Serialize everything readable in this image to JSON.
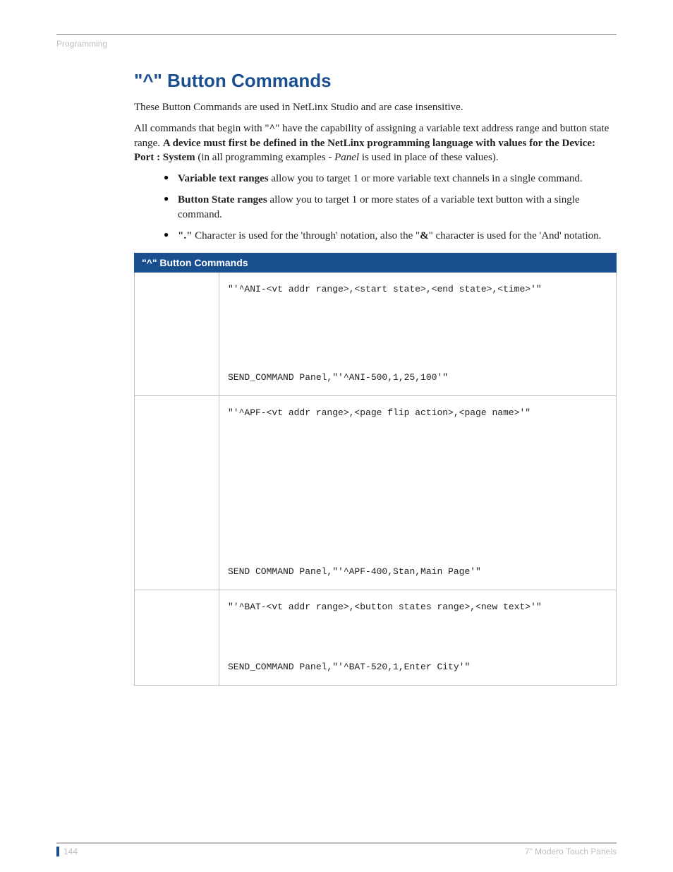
{
  "header": {
    "section": "Programming"
  },
  "title": "\"^\" Button Commands",
  "intro1": "These Button Commands are used in NetLinx Studio and are case insensitive.",
  "intro2_pre": "All commands that begin with \"",
  "intro2_sym": "^",
  "intro2_mid": "\" have the capability of assigning a variable text address range and button state range. ",
  "intro2_bold": "A device must first be defined in the NetLinx programming language with values for the Device: Port : System",
  "intro2_post1": " (in all programming examples - ",
  "intro2_panel": "Panel",
  "intro2_post2": " is used in place of these values).",
  "bullets": {
    "b1_bold": "Variable text ranges",
    "b1_rest": " allow you to target 1 or more variable text channels in a single command.",
    "b2_bold": "Button State ranges",
    "b2_rest": " allow you to target 1 or more states of a variable text button with a single command.",
    "b3_bold": "\".\"",
    "b3_mid": " Character is used for the 'through' notation, also the \"",
    "b3_amp": "&",
    "b3_rest": "\" character is used for the 'And' notation."
  },
  "table": {
    "header": "\"^\" Button Commands",
    "rows": [
      {
        "syntax": "\"'^ANI-<vt addr range>,<start state>,<end state>,<time>'\"",
        "example": "SEND_COMMAND Panel,\"'^ANI-500,1,25,100'\""
      },
      {
        "syntax": "\"'^APF-<vt addr range>,<page flip action>,<page name>'\"",
        "example": "SEND COMMAND Panel,\"'^APF-400,Stan,Main Page'\""
      },
      {
        "syntax": "\"'^BAT-<vt addr range>,<button states range>,<new text>'\"",
        "example": "SEND_COMMAND Panel,\"'^BAT-520,1,Enter City'\""
      }
    ]
  },
  "footer": {
    "page": "144",
    "doc": "7\" Modero Touch Panels"
  }
}
